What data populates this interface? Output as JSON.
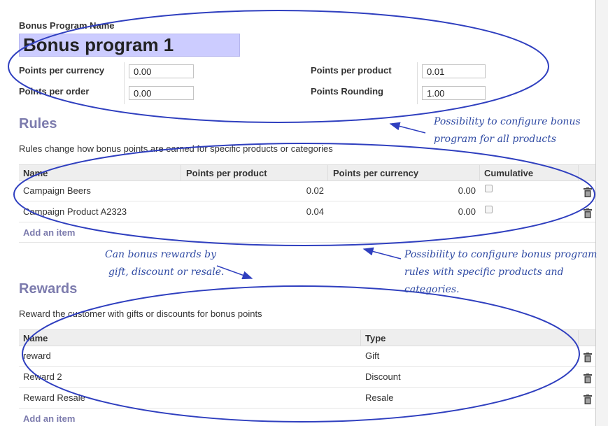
{
  "program": {
    "name_label": "Bonus Program Name",
    "name_value": "Bonus program 1",
    "points_per_currency_label": "Points per currency",
    "points_per_currency_value": "0.00",
    "points_per_order_label": "Points per order",
    "points_per_order_value": "0.00",
    "points_per_product_label": "Points per product",
    "points_per_product_value": "0.01",
    "points_rounding_label": "Points Rounding",
    "points_rounding_value": "1.00"
  },
  "rules": {
    "heading": "Rules",
    "description": "Rules change how bonus points are earned for specific products or categories",
    "columns": [
      "Name",
      "Points per product",
      "Points per currency",
      "Cumulative"
    ],
    "rows": [
      {
        "name": "Campaign Beers",
        "points_per_product": "0.02",
        "points_per_currency": "0.00",
        "cumulative": false
      },
      {
        "name": "Campaign Product A2323",
        "points_per_product": "0.04",
        "points_per_currency": "0.00",
        "cumulative": false
      }
    ],
    "add_item": "Add an item"
  },
  "rewards": {
    "heading": "Rewards",
    "description": "Reward the customer with gifts or discounts for bonus points",
    "columns": [
      "Name",
      "Type"
    ],
    "rows": [
      {
        "name": "reward",
        "type": "Gift"
      },
      {
        "name": "Reward 2",
        "type": "Discount"
      },
      {
        "name": "Reward Resale",
        "type": "Resale"
      }
    ],
    "add_item": "Add an item"
  },
  "annotations": {
    "note1_line1": "Possibility to configure bonus",
    "note1_line2": "program for all products",
    "note2_line1": "Possibility to configure bonus program",
    "note2_line2": "rules with specific products and categories.",
    "note3_line1": "Can bonus rewards by",
    "note3_line2": "gift, discount or resale."
  },
  "colors": {
    "accent": "#7c7bad",
    "title_input_bg": "#ccccff",
    "annotation_ink": "#2f3fbf"
  },
  "icons": [
    "trash-icon",
    "checkbox"
  ]
}
